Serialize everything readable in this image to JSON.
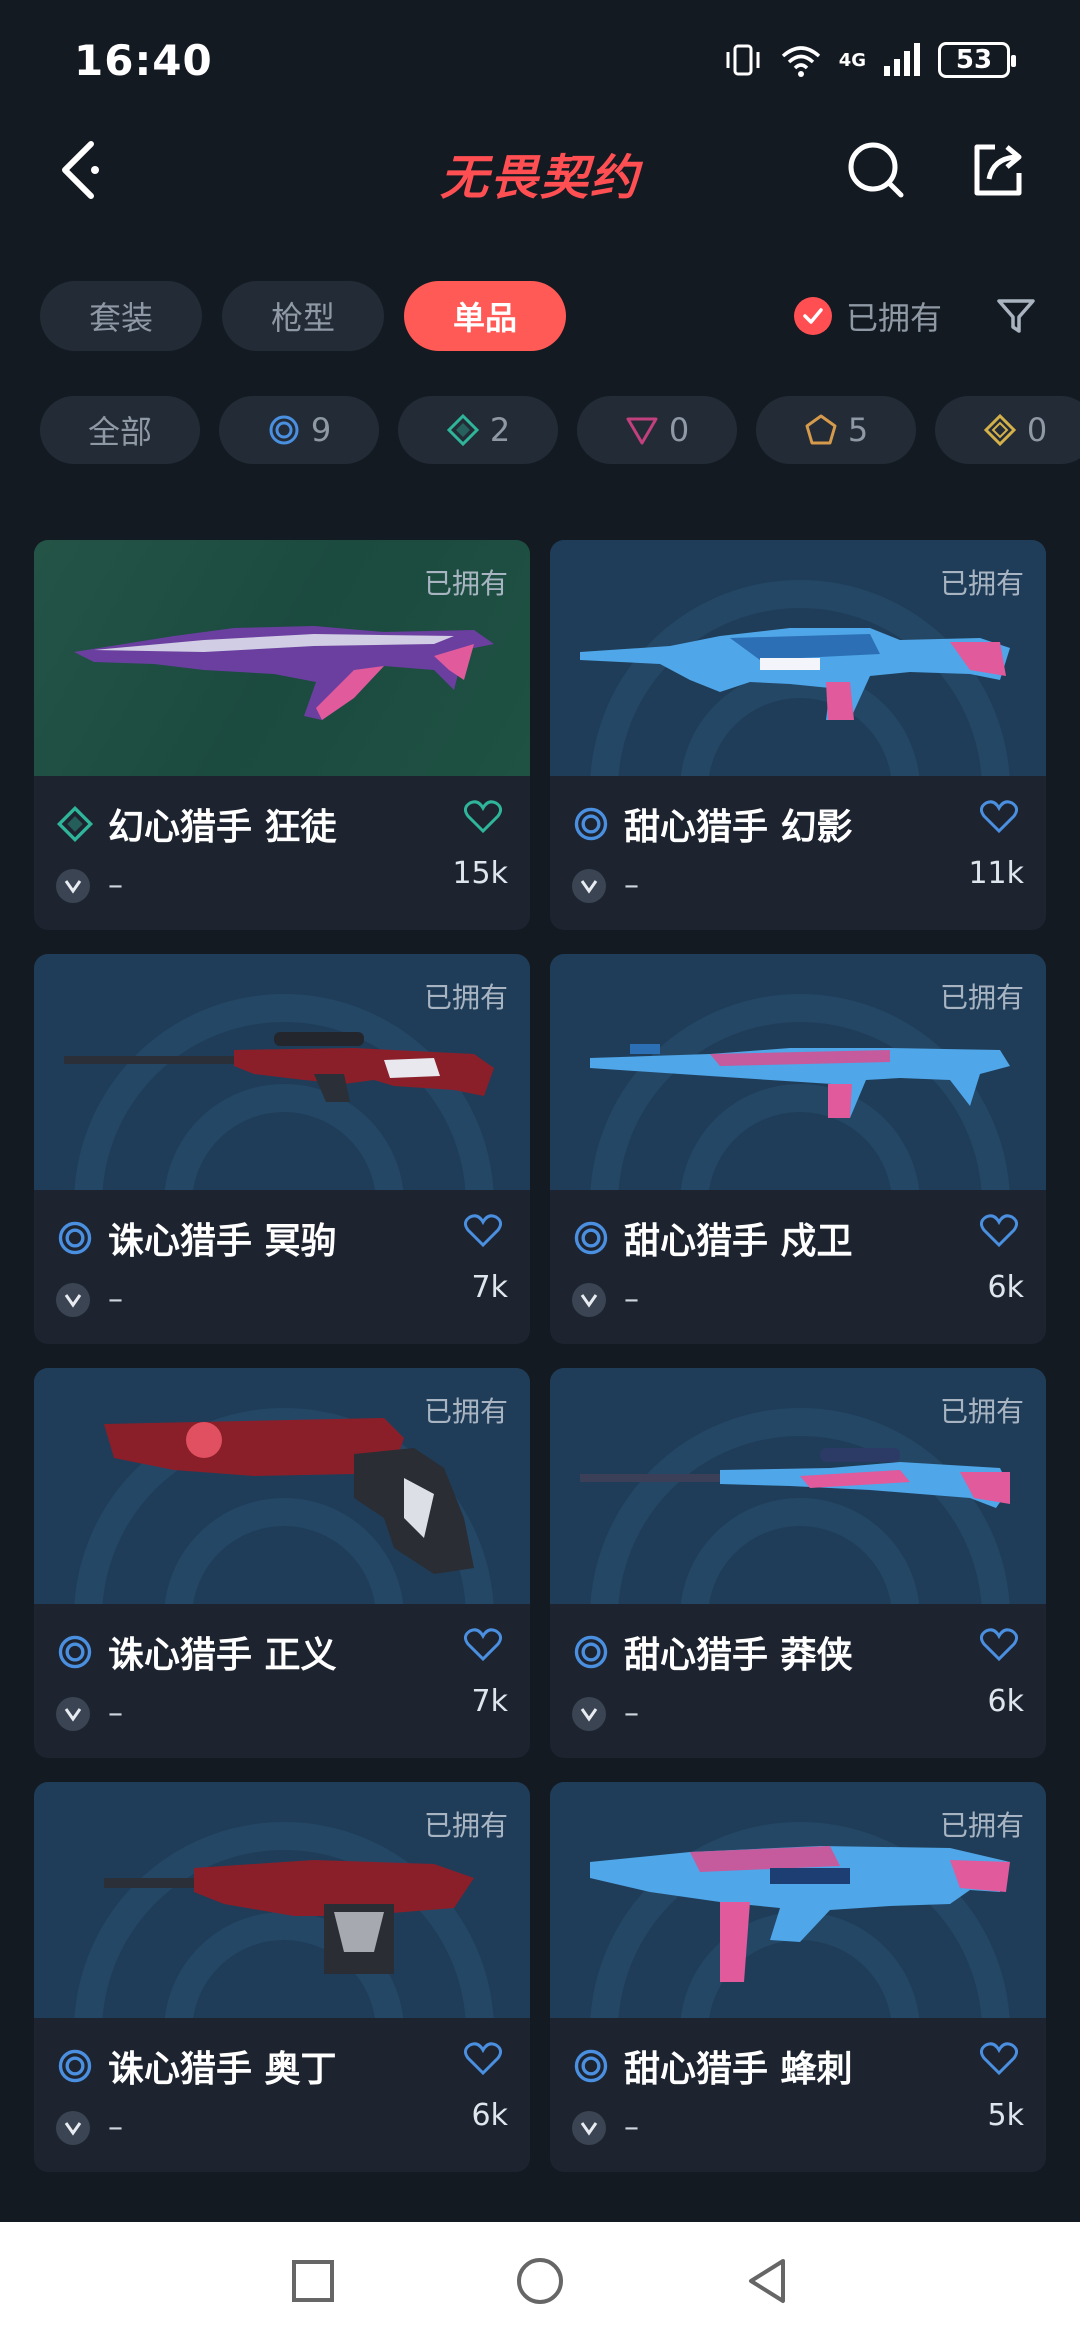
{
  "status": {
    "time": "16:40",
    "network": "4G",
    "battery": "53"
  },
  "header": {
    "title": "无畏契约"
  },
  "filters": {
    "categories": [
      {
        "label": "套装",
        "active": false
      },
      {
        "label": "枪型",
        "active": false
      },
      {
        "label": "单品",
        "active": true
      }
    ],
    "owned_label": "已拥有"
  },
  "tiers": [
    {
      "label": "全部",
      "icon": ""
    },
    {
      "label": "9",
      "icon": "select-tier-icon",
      "color": "#4a8fe0"
    },
    {
      "label": "2",
      "icon": "deluxe-tier-icon",
      "color": "#2fb59a"
    },
    {
      "label": "0",
      "icon": "premium-tier-icon",
      "color": "#c2407e"
    },
    {
      "label": "5",
      "icon": "ultra-tier-icon",
      "color": "#d59a4c"
    },
    {
      "label": "0",
      "icon": "exclusive-tier-icon",
      "color": "#d3b04a"
    }
  ],
  "items": [
    {
      "name": "幻心猎手 狂徒",
      "owned": "已拥有",
      "likes": "15k",
      "sub": "–",
      "tier": "deluxe-tier-icon",
      "tier_color": "#2fb59a",
      "bg": "green",
      "weapon": "vandal-rifle-icon"
    },
    {
      "name": "甜心猎手 幻影",
      "owned": "已拥有",
      "likes": "11k",
      "sub": "–",
      "tier": "select-tier-icon",
      "tier_color": "#4a8fe0",
      "bg": "blue",
      "weapon": "phantom-rifle-icon"
    },
    {
      "name": "诛心猎手 冥驹",
      "owned": "已拥有",
      "likes": "7k",
      "sub": "–",
      "tier": "select-tier-icon",
      "tier_color": "#4a8fe0",
      "bg": "blue",
      "weapon": "operator-sniper-icon"
    },
    {
      "name": "甜心猎手 戍卫",
      "owned": "已拥有",
      "likes": "6k",
      "sub": "–",
      "tier": "select-tier-icon",
      "tier_color": "#4a8fe0",
      "bg": "blue",
      "weapon": "guardian-rifle-icon"
    },
    {
      "name": "诛心猎手 正义",
      "owned": "已拥有",
      "likes": "7k",
      "sub": "–",
      "tier": "select-tier-icon",
      "tier_color": "#4a8fe0",
      "bg": "blue",
      "weapon": "sheriff-revolver-icon"
    },
    {
      "name": "甜心猎手 莽侠",
      "owned": "已拥有",
      "likes": "6k",
      "sub": "–",
      "tier": "select-tier-icon",
      "tier_color": "#4a8fe0",
      "bg": "blue",
      "weapon": "marshal-sniper-icon"
    },
    {
      "name": "诛心猎手 奥丁",
      "owned": "已拥有",
      "likes": "6k",
      "sub": "–",
      "tier": "select-tier-icon",
      "tier_color": "#4a8fe0",
      "bg": "blue",
      "weapon": "odin-machinegun-icon"
    },
    {
      "name": "甜心猎手 蜂刺",
      "owned": "已拥有",
      "likes": "5k",
      "sub": "–",
      "tier": "select-tier-icon",
      "tier_color": "#4a8fe0",
      "bg": "blue",
      "weapon": "spectre-smg-icon"
    }
  ]
}
